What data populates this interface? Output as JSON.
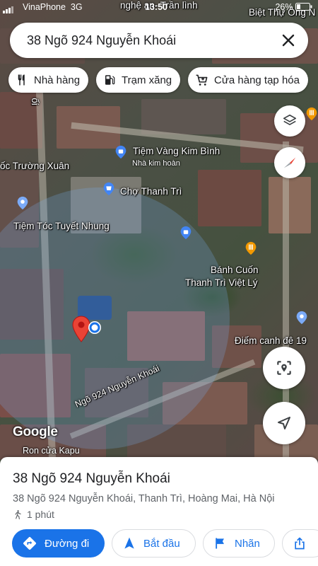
{
  "status_bar": {
    "carrier": "VinaPhone",
    "network": "3G",
    "time": "13:50",
    "battery": "26%"
  },
  "search": {
    "value": "38 Ngõ 924 Nguyễn Khoái",
    "close_icon": "close-icon"
  },
  "chips": [
    {
      "label": "Nhà hàng",
      "icon": "restaurant-icon"
    },
    {
      "label": "Trạm xăng",
      "icon": "gas-station-icon"
    },
    {
      "label": "Cửa hàng tạp hóa",
      "icon": "cart-icon"
    }
  ],
  "map": {
    "labels": {
      "top_street": "nghệ an- Trần lình",
      "top_right": "Biệt Thự Ông N",
      "left_side": "ối",
      "toc_truong_xuan": "ốc Trường Xuân",
      "tiem_vang": "Tiệm Vàng Kim Bình",
      "tiem_vang_sub": "Nhà kim hoàn",
      "cho_thanh_tri": "Chợ Thanh Trì",
      "tiem_toc": "Tiệm Tóc Tuyết Nhung",
      "banh_cuon_1": "Bánh Cuốn",
      "banh_cuon_2": "Thanh Trì Việt Lý",
      "diem_canh": "Điếm canh đê 19",
      "street_label": "Ngõ 924 Nguyễn Khoái",
      "ron_cua": "Ron cửa Kapu"
    },
    "google_logo": "Google",
    "colors": {
      "pin_red": "#ea4335",
      "poi_blue": "#4285f4",
      "poi_orange": "#f29900",
      "accent": "#1a73e8"
    }
  },
  "sheet": {
    "title": "38 Ngõ 924 Nguyễn Khoái",
    "address": "38 Ngõ 924 Nguyễn Khoái, Thanh Trì, Hoàng Mai, Hà Nội",
    "walk_time": "1 phút",
    "actions": [
      {
        "label": "Đường đi",
        "icon": "directions-icon"
      },
      {
        "label": "Bắt đầu",
        "icon": "navigation-icon"
      },
      {
        "label": "Nhãn",
        "icon": "flag-icon"
      },
      {
        "label": "",
        "icon": "share-icon"
      }
    ]
  }
}
